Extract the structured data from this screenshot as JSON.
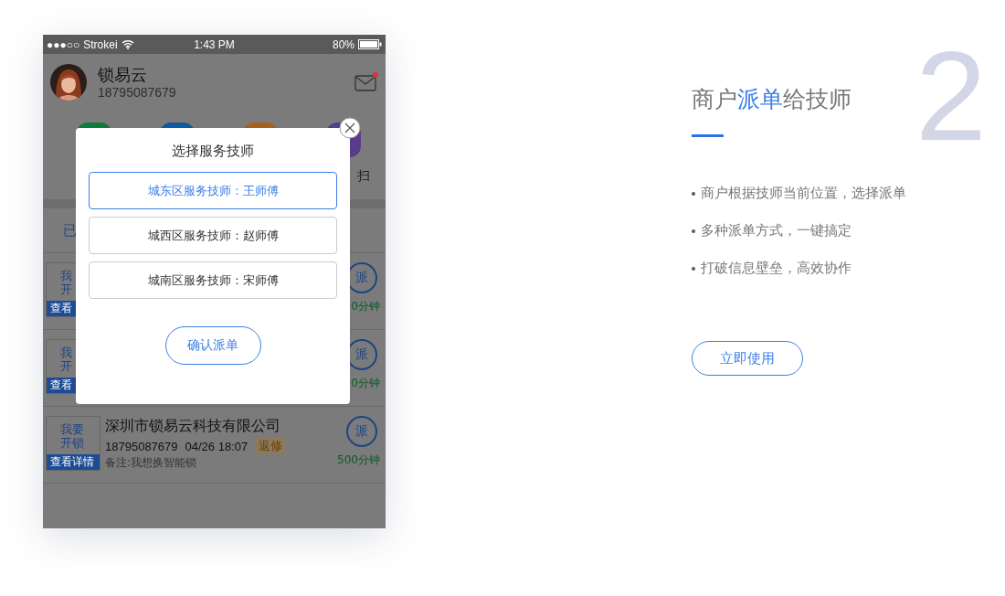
{
  "phone": {
    "status_bar": {
      "signal": "●●●○○",
      "carrier": "Strokei",
      "time": "1:43 PM",
      "battery": "80%"
    },
    "profile": {
      "name": "锁易云",
      "phone": "18795087679",
      "unread": true
    },
    "shortcuts": [
      {
        "color": "#0b7a3c"
      },
      {
        "color": "#0d5a9c"
      },
      {
        "color": "#a8601c"
      },
      {
        "color": "#5a3c8c",
        "label": "扫"
      }
    ],
    "tabs": [
      {
        "label": "已"
      }
    ],
    "orders": [
      {
        "action_lines": [
          "我",
          "开"
        ],
        "details": "查看",
        "dispatch": "派",
        "duration": "0分钟"
      },
      {
        "action_lines": [
          "我",
          "开"
        ],
        "details": "查看",
        "dispatch": "派",
        "duration": "0分钟"
      },
      {
        "action_lines": [
          "我要",
          "开锁"
        ],
        "details": "查看详情",
        "company": "深圳市锁易云科技有限公司",
        "phone": "18795087679",
        "time": "04/26 18:07",
        "tag": "返修",
        "note": "备注:我想换智能锁",
        "dispatch": "派",
        "duration": "500分钟"
      }
    ],
    "modal": {
      "title": "选择服务技师",
      "options": [
        {
          "label": "城东区服务技师：王师傅",
          "selected": true
        },
        {
          "label": "城西区服务技师：赵师傅",
          "selected": false
        },
        {
          "label": "城南区服务技师：宋师傅",
          "selected": false
        }
      ],
      "confirm": "确认派单"
    }
  },
  "feature": {
    "number": "2",
    "title": [
      {
        "text": "商户",
        "highlight": false
      },
      {
        "text": "派单",
        "highlight": true
      },
      {
        "text": "给技师",
        "highlight": false
      }
    ],
    "bullets": [
      "商户根据技师当前位置，选择派单",
      "多种派单方式，一键搞定",
      "打破信息壁垒，高效协作"
    ],
    "button": "立即使用"
  }
}
